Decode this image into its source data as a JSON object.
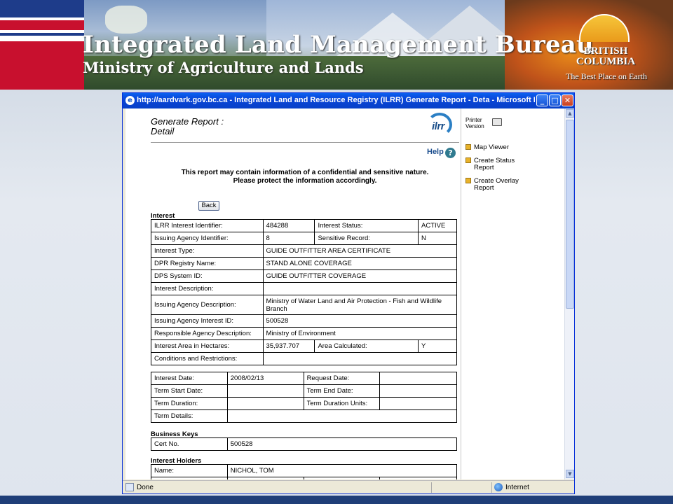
{
  "banner": {
    "title": "Integrated Land Management Bureau",
    "subtitle": "Ministry of Agriculture and Lands",
    "bc_name_line1": "BRITISH",
    "bc_name_line2": "COLUMBIA",
    "bc_tagline": "The Best Place on Earth"
  },
  "window": {
    "title": "http://aardvark.gov.bc.ca - Integrated Land and Resource Registry (ILRR) Generate Report - Deta - Microsoft Internet Ex...",
    "status_text": "Done",
    "zone_text": "Internet"
  },
  "page": {
    "heading_line1": "Generate Report :",
    "heading_line2": "Detail",
    "logo_text": "ilrr",
    "help_label": "Help",
    "notice_line1": "This report may contain information of a confidential and sensitive nature.",
    "notice_line2": "Please protect the information accordingly.",
    "back_label": "Back"
  },
  "right_panel": {
    "printer_line1": "Printer",
    "printer_line2": "Version",
    "links": [
      {
        "line1": "Map Viewer",
        "line2": ""
      },
      {
        "line1": "Create Status",
        "line2": "Report"
      },
      {
        "line1": "Create Overlay",
        "line2": "Report"
      }
    ]
  },
  "interest": {
    "section_title": "Interest",
    "rows4": [
      [
        "ILRR Interest Identifier:",
        "484288",
        "Interest Status:",
        "ACTIVE"
      ],
      [
        "Issuing Agency Identifier:",
        "8",
        "Sensitive Record:",
        "N"
      ]
    ],
    "rows2": [
      [
        "Interest Type:",
        "GUIDE OUTFITTER AREA CERTIFICATE"
      ],
      [
        "DPR Registry Name:",
        "STAND ALONE COVERAGE"
      ],
      [
        "DPS System ID:",
        "GUIDE OUTFITTER COVERAGE"
      ],
      [
        "Interest Description:",
        ""
      ],
      [
        "Issuing Agency Description:",
        "Ministry of Water Land and Air Protection - Fish and Wildlife Branch"
      ],
      [
        "Issuing Agency Interest ID:",
        "500528"
      ],
      [
        "Responsible Agency Description:",
        "Ministry of Environment"
      ]
    ],
    "area_row": [
      "Interest Area in Hectares:",
      "35,937.707",
      "Area Calculated:",
      "Y"
    ],
    "conditions_row": [
      "Conditions and Restrictions:",
      ""
    ]
  },
  "dates": {
    "rows": [
      [
        "Interest Date:",
        "2008/02/13",
        "Request Date:",
        ""
      ],
      [
        "Term Start Date:",
        "",
        "Term End Date:",
        ""
      ],
      [
        "Term Duration:",
        "",
        "Term Duration Units:",
        ""
      ]
    ],
    "details_row": [
      "Term Details:",
      ""
    ]
  },
  "business_keys": {
    "section_title": "Business Keys",
    "row": [
      "Cert No.",
      "500528"
    ]
  },
  "holders": {
    "section_title": "Interest Holders",
    "row": [
      "Name:",
      "NICHOL, TOM"
    ]
  }
}
